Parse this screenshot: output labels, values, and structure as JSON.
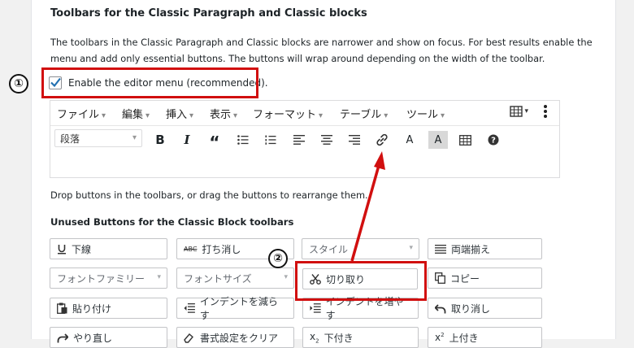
{
  "section": {
    "title": "Toolbars for the Classic Paragraph and Classic blocks",
    "description": "The toolbars in the Classic Paragraph and Classic blocks are narrower and show on focus. For best results enable the menu and add only essential buttons. The buttons will wrap around depending on the width of the toolbar.",
    "enable_label": "Enable the editor menu (recommended).",
    "enable_checked": true
  },
  "editor": {
    "menus": [
      "ファイル",
      "編集",
      "挿入",
      "表示",
      "フォーマット",
      "テーブル",
      "ツール"
    ],
    "format_select": "段落",
    "toolbar_icons": [
      "bold-icon",
      "italic-icon",
      "blockquote-icon",
      "bullet-list-icon",
      "numbered-list-icon",
      "align-left-icon",
      "align-center-icon",
      "align-right-icon",
      "link-icon",
      "text-color-icon",
      "background-color-icon",
      "table-icon",
      "help-icon"
    ]
  },
  "drop_text": "Drop buttons in the toolbars, or drag the buttons to rearrange them.",
  "unused_title": "Unused Buttons for the Classic Block toolbars",
  "unused_buttons": {
    "underline": "下線",
    "strikethrough": "打ち消し",
    "style": "スタイル",
    "justify": "両端揃え",
    "font_family": "フォントファミリー",
    "font_size": "フォントサイズ",
    "cut": "切り取り",
    "copy": "コピー",
    "paste": "貼り付け",
    "outdent": "インデントを減らす",
    "indent": "インデントを増やす",
    "undo": "取り消し",
    "redo": "やり直し",
    "clear_format": "書式設定をクリア",
    "subscript": "下付き",
    "superscript": "上付き"
  },
  "annotations": {
    "one": "①",
    "two": "②"
  },
  "colors": {
    "annotation_red": "#d10f0f",
    "accent": "#2271b1"
  }
}
